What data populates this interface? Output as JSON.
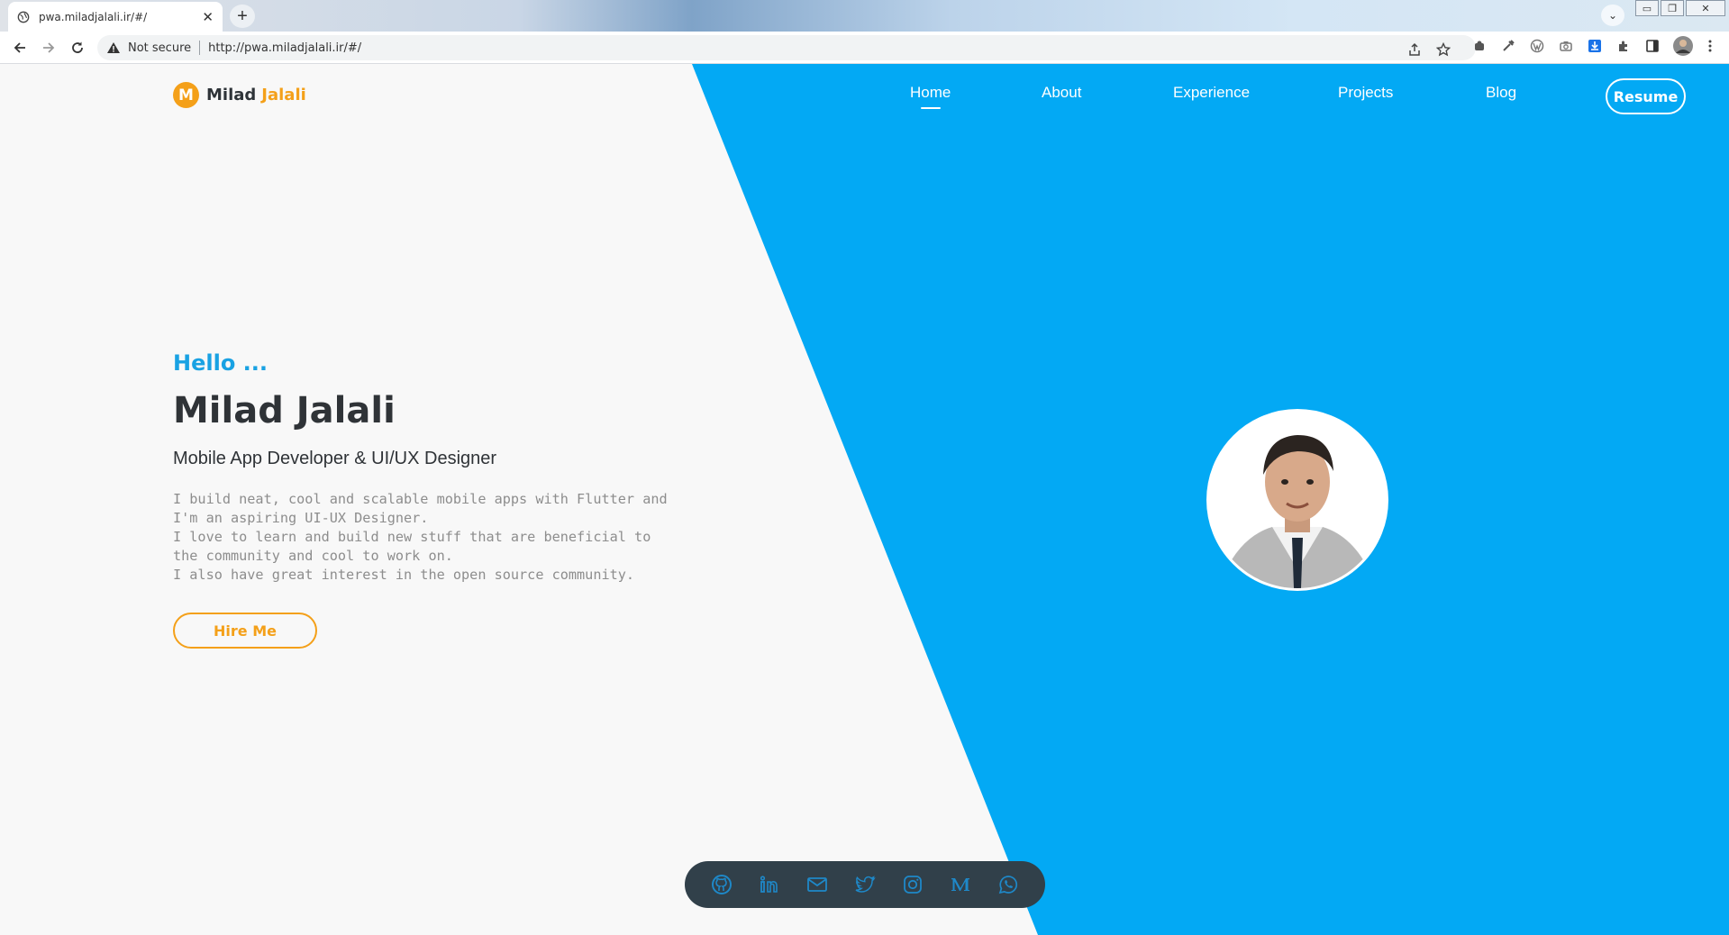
{
  "browser": {
    "tab_title": "pwa.miladjalali.ir/#/",
    "new_tab_symbol": "+",
    "address_warning": "Not secure",
    "url": "http://pwa.miladjalali.ir/#/",
    "window_controls": [
      "minimize-icon",
      "restore-icon",
      "close-icon"
    ],
    "toolbar_icons": [
      "share-icon",
      "star-icon",
      "extension-icon",
      "eyedropper-icon",
      "wordpress-icon",
      "camera-icon",
      "download-icon",
      "puzzle-icon",
      "sidepanel-icon",
      "profile-avatar",
      "menu-icon"
    ]
  },
  "site": {
    "logo_letter": "M",
    "logo_first": "Milad",
    "logo_last": "Jalali",
    "nav": [
      {
        "label": "Home",
        "active": true
      },
      {
        "label": "About",
        "active": false
      },
      {
        "label": "Experience",
        "active": false
      },
      {
        "label": "Projects",
        "active": false
      },
      {
        "label": "Blog",
        "active": false
      }
    ],
    "resume_label": "Resume",
    "colors": {
      "accent_blue": "#03a9f4",
      "accent_orange": "#f4a019",
      "text_dark": "#2f3337",
      "hello_blue": "#19a2e3"
    }
  },
  "hero": {
    "greeting": "Hello ...",
    "name": "Milad Jalali",
    "role": "Mobile App Developer & UI/UX Designer",
    "description": [
      "I build neat, cool and scalable mobile apps with Flutter and I'm an aspiring UI-UX Designer.",
      "I love to learn and build new stuff that are beneficial to the community and cool to work on.",
      "I also have great interest in the open source community."
    ],
    "hire_label": "Hire Me"
  },
  "social_icons": [
    "github-icon",
    "linkedin-icon",
    "email-icon",
    "twitter-icon",
    "instagram-icon",
    "medium-icon",
    "whatsapp-icon"
  ]
}
